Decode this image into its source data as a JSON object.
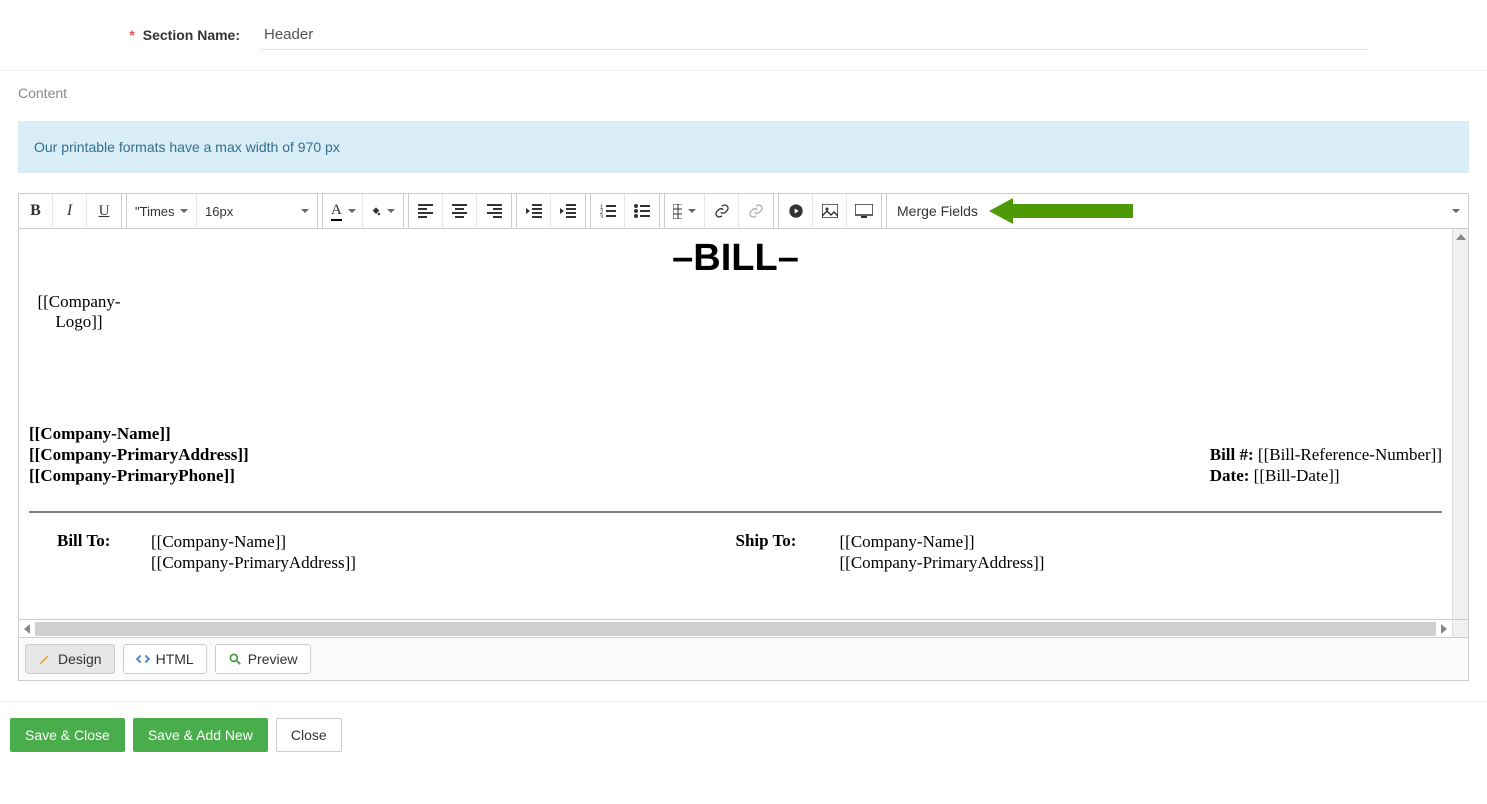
{
  "form": {
    "section_name_label": "Section Name:",
    "section_name_value": "Header"
  },
  "content": {
    "label": "Content",
    "info": "Our printable formats have a max width of 970 px"
  },
  "toolbar": {
    "font_family": "\"Times Ne…",
    "font_size": "16px",
    "merge_fields_label": "Merge Fields"
  },
  "document": {
    "title": "–BILL–",
    "logo": "[[Company-Logo]]",
    "company_name": "[[Company-Name]]",
    "company_address": "[[Company-PrimaryAddress]]",
    "company_phone": "[[Company-PrimaryPhone]]",
    "bill_number_label": "Bill #:",
    "bill_number_value": "[[Bill-Reference-Number]]",
    "date_label": "Date:",
    "date_value": "[[Bill-Date]]",
    "bill_to_label": "Bill To:",
    "bill_to_name": "[[Company-Name]]",
    "bill_to_address": "[[Company-PrimaryAddress]]",
    "ship_to_label": "Ship To:",
    "ship_to_name": "[[Company-Name]]",
    "ship_to_address": "[[Company-PrimaryAddress]]"
  },
  "tabs": {
    "design": "Design",
    "html": "HTML",
    "preview": "Preview"
  },
  "footer": {
    "save_close": "Save & Close",
    "save_add_new": "Save & Add New",
    "close": "Close"
  }
}
